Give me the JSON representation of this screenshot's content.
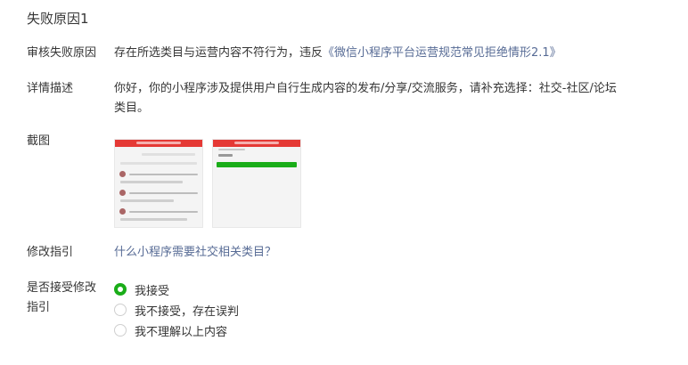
{
  "section": {
    "title": "失败原因1"
  },
  "review_reason": {
    "label": "审核失败原因",
    "text_prefix": "存在所选类目与运营内容不符行为，违反",
    "link": "《微信小程序平台运营规范常见拒绝情形2.1》"
  },
  "detail": {
    "label": "详情描述",
    "text_line1": "你好，你的小程序涉及提供用户自行生成内容的发布/分享/交流服务，请补充选择：社交-社区/论坛",
    "text_line2": "类目。"
  },
  "screenshots": {
    "label": "截图"
  },
  "guide": {
    "label": "修改指引",
    "link": "什么小程序需要社交相关类目？"
  },
  "accept": {
    "label_line1": "是否接受修改",
    "label_line2": "指引",
    "options": [
      {
        "label": "我接受",
        "checked": true
      },
      {
        "label": "我不接受，存在误判",
        "checked": false
      },
      {
        "label": "我不理解以上内容",
        "checked": false
      }
    ]
  },
  "colors": {
    "accent_green": "#1aad19",
    "link_blue": "#576b95",
    "banner_red": "#e53935"
  }
}
